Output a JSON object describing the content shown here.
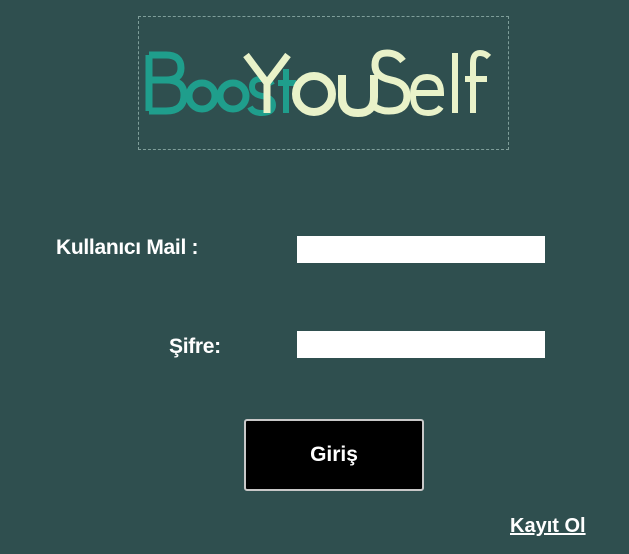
{
  "logo": {
    "parts": [
      "Boost",
      "You",
      "Self"
    ],
    "colors": {
      "teal": "#1f9e8c",
      "teal_dark": "#1b7f73",
      "cream": "#e9f2c9"
    }
  },
  "form": {
    "mail_label": "Kullanıcı Mail :",
    "mail_value": "",
    "password_label": "Şifre:",
    "password_value": "",
    "submit_label": "Giriş"
  },
  "footer": {
    "register_link": "Kayıt Ol"
  },
  "colors": {
    "background": "#2f4f4f",
    "button_bg": "#000000",
    "text": "#ffffff"
  }
}
